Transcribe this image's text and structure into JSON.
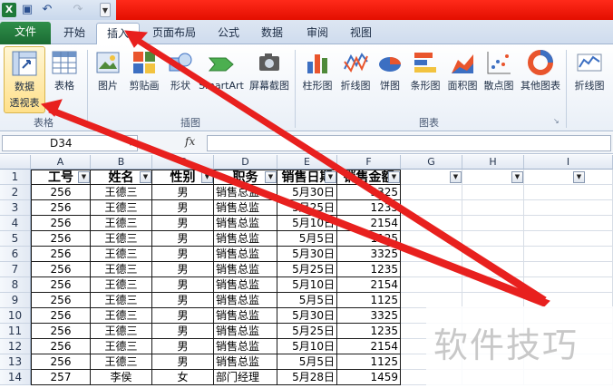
{
  "tabs": {
    "file": "文件",
    "home": "开始",
    "insert": "插入",
    "page_layout": "页面布局",
    "formulas": "公式",
    "data": "数据",
    "review": "审阅",
    "view": "视图"
  },
  "ribbon": {
    "pivot_line1": "数据",
    "pivot_line2": "透视表",
    "table": "表格",
    "picture": "图片",
    "clipart": "剪贴画",
    "shapes": "形状",
    "smartart": "SmartArt",
    "screenshot": "屏幕截图",
    "column": "柱形图",
    "line": "折线图",
    "pie": "饼图",
    "bar": "条形图",
    "area": "面积图",
    "scatter": "散点图",
    "other": "其他图表",
    "sparkline_line": "折线图",
    "groups": {
      "tables": "表格",
      "illustrations": "插图",
      "charts": "图表"
    }
  },
  "formula_bar": {
    "name_box": "D34",
    "fx": "fx"
  },
  "columns": [
    "A",
    "B",
    "C",
    "D",
    "E",
    "F",
    "G",
    "H",
    "I"
  ],
  "table": {
    "headers": [
      "工号",
      "姓名",
      "性别",
      "职务",
      "销售日期",
      "销售金额"
    ],
    "rows": [
      [
        "256",
        "王德三",
        "男",
        "销售总监",
        "5月30日",
        "3325"
      ],
      [
        "256",
        "王德三",
        "男",
        "销售总监",
        "5月25日",
        "1235"
      ],
      [
        "256",
        "王德三",
        "男",
        "销售总监",
        "5月10日",
        "2154"
      ],
      [
        "256",
        "王德三",
        "男",
        "销售总监",
        "5月5日",
        "1125"
      ],
      [
        "256",
        "王德三",
        "男",
        "销售总监",
        "5月30日",
        "3325"
      ],
      [
        "256",
        "王德三",
        "男",
        "销售总监",
        "5月25日",
        "1235"
      ],
      [
        "256",
        "王德三",
        "男",
        "销售总监",
        "5月10日",
        "2154"
      ],
      [
        "256",
        "王德三",
        "男",
        "销售总监",
        "5月5日",
        "1125"
      ],
      [
        "256",
        "王德三",
        "男",
        "销售总监",
        "5月30日",
        "3325"
      ],
      [
        "256",
        "王德三",
        "男",
        "销售总监",
        "5月25日",
        "1235"
      ],
      [
        "256",
        "王德三",
        "男",
        "销售总监",
        "5月10日",
        "2154"
      ],
      [
        "256",
        "王德三",
        "男",
        "销售总监",
        "5月5日",
        "1125"
      ],
      [
        "257",
        "李侯",
        "女",
        "部门经理",
        "5月28日",
        "1459"
      ]
    ]
  },
  "watermark": "软件技巧",
  "colors": {
    "file_tab": "#1b6b33",
    "title_red": "#e30e00",
    "arrow": "#e8201e"
  }
}
